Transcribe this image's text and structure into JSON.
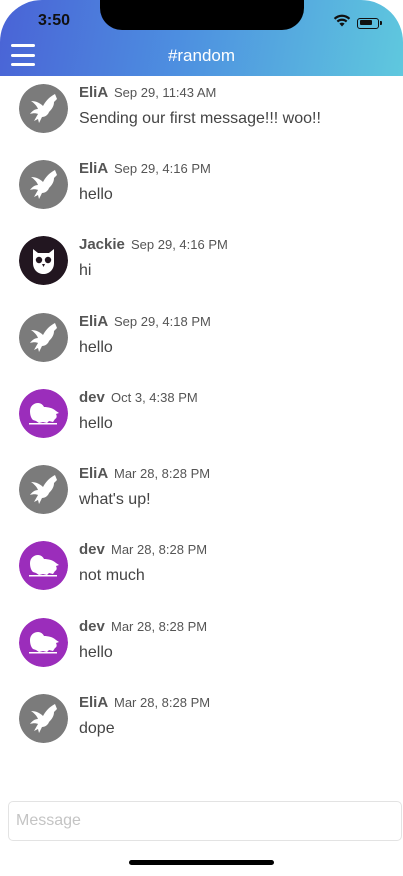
{
  "status_bar": {
    "time": "3:50"
  },
  "header": {
    "title": "#random"
  },
  "messages": [
    {
      "author": "EliA",
      "time": "Sep 29, 11:43 AM",
      "text": "Sending our first message!!! woo!!",
      "avatar": "eagle-icon"
    },
    {
      "author": "EliA",
      "time": "Sep 29, 4:16 PM",
      "text": "hello",
      "avatar": "eagle-icon"
    },
    {
      "author": "Jackie",
      "time": "Sep 29, 4:16 PM",
      "text": "hi",
      "avatar": "owl-icon"
    },
    {
      "author": "EliA",
      "time": "Sep 29, 4:18 PM",
      "text": "hello",
      "avatar": "eagle-icon"
    },
    {
      "author": "dev",
      "time": "Oct 3, 4:38 PM",
      "text": "hello",
      "avatar": "lion-icon"
    },
    {
      "author": "EliA",
      "time": "Mar 28, 8:28 PM",
      "text": "what's up!",
      "avatar": "eagle-icon"
    },
    {
      "author": "dev",
      "time": "Mar 28, 8:28 PM",
      "text": "not much",
      "avatar": "lion-icon"
    },
    {
      "author": "dev",
      "time": "Mar 28, 8:28 PM",
      "text": "hello",
      "avatar": "lion-icon"
    },
    {
      "author": "EliA",
      "time": "Mar 28, 8:28 PM",
      "text": "dope",
      "avatar": "eagle-icon"
    }
  ],
  "composer": {
    "placeholder": "Message",
    "value": ""
  },
  "colors": {
    "eagle_avatar_bg": "#7b7b7b",
    "lion_avatar_bg": "#9b2dbb",
    "owl_avatar_bg": "#221620"
  }
}
